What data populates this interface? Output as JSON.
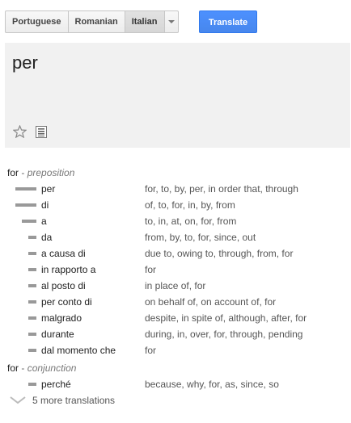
{
  "languages": {
    "buttons": [
      "Portuguese",
      "Romanian",
      "Italian"
    ],
    "selected": "Italian",
    "translate_label": "Translate"
  },
  "source": {
    "text": "per"
  },
  "dictionary": {
    "sections": [
      {
        "word": "for",
        "dash": "-",
        "pos": "preposition",
        "entries": [
          {
            "word": "per",
            "translations": "for, to, by, per, in order that, through",
            "frequency": "common"
          },
          {
            "word": "di",
            "translations": "of, to, for, in, by, from",
            "frequency": "common"
          },
          {
            "word": "a",
            "translations": "to, in, at, on, for, from",
            "frequency": "uncommon"
          },
          {
            "word": "da",
            "translations": "from, by, to, for, since, out",
            "frequency": "rare"
          },
          {
            "word": "a causa di",
            "translations": "due to, owing to, through, from, for",
            "frequency": "rare"
          },
          {
            "word": "in rapporto a",
            "translations": "for",
            "frequency": "rare"
          },
          {
            "word": "al posto di",
            "translations": "in place of, for",
            "frequency": "rare"
          },
          {
            "word": "per conto di",
            "translations": "on behalf of, on account of, for",
            "frequency": "rare"
          },
          {
            "word": "malgrado",
            "translations": "despite, in spite of, although, after, for",
            "frequency": "rare"
          },
          {
            "word": "durante",
            "translations": "during, in, over, for, through, pending",
            "frequency": "rare"
          },
          {
            "word": "dal momento che",
            "translations": "for",
            "frequency": "rare"
          }
        ]
      },
      {
        "word": "for",
        "dash": "-",
        "pos": "conjunction",
        "entries": [
          {
            "word": "perché",
            "translations": "because, why, for, as, since, so",
            "frequency": "rare"
          }
        ]
      }
    ],
    "more_label": "5 more translations"
  },
  "icons": {
    "star": "star-icon",
    "list": "list-icon",
    "more": "chevron-down-icon"
  }
}
